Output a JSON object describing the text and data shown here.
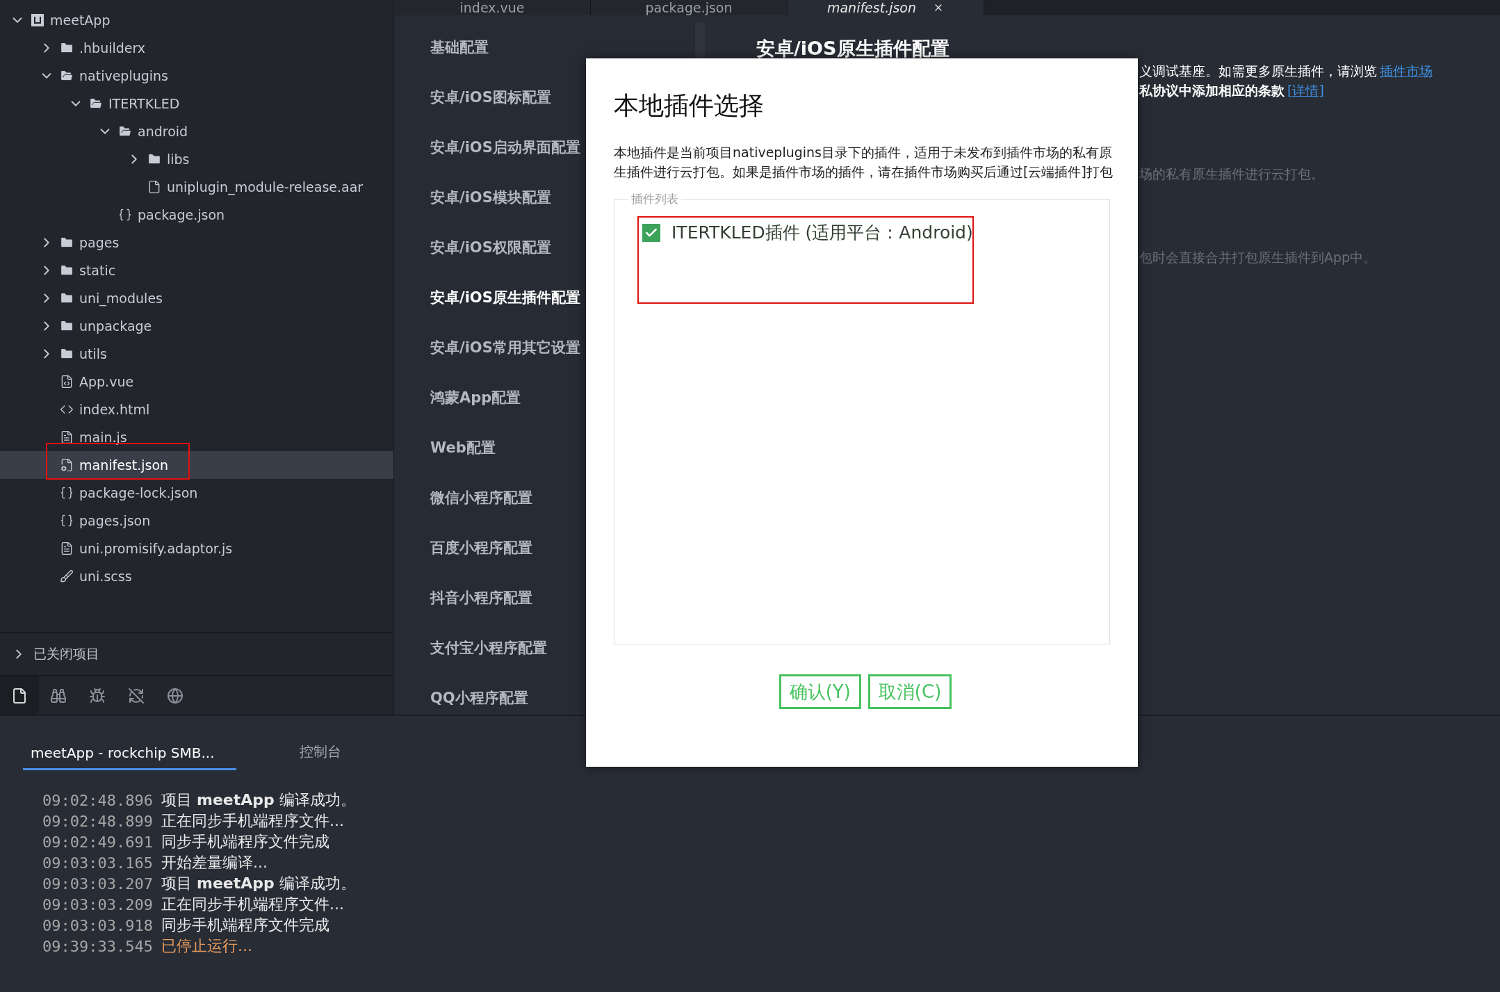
{
  "tree": [
    {
      "name": "meetApp",
      "kind": "project",
      "expanded": true,
      "selected": false,
      "children": [
        {
          "name": ".hbuilderx",
          "kind": "folder",
          "expanded": false,
          "selected": false
        },
        {
          "name": "nativeplugins",
          "kind": "folder",
          "expanded": true,
          "selected": false,
          "children": [
            {
              "name": "ITERTKLED",
              "kind": "folder",
              "expanded": true,
              "selected": false,
              "children": [
                {
                  "name": "android",
                  "kind": "folder",
                  "expanded": true,
                  "selected": false,
                  "children": [
                    {
                      "name": "libs",
                      "kind": "folder",
                      "expanded": false,
                      "selected": false
                    },
                    {
                      "name": "uniplugin_module-release.aar",
                      "kind": "file",
                      "selected": false
                    }
                  ]
                },
                {
                  "name": "package.json",
                  "kind": "json",
                  "selected": false
                }
              ]
            }
          ]
        },
        {
          "name": "pages",
          "kind": "folder",
          "expanded": false,
          "selected": false
        },
        {
          "name": "static",
          "kind": "folder",
          "expanded": false,
          "selected": false
        },
        {
          "name": "uni_modules",
          "kind": "folder",
          "expanded": false,
          "selected": false
        },
        {
          "name": "unpackage",
          "kind": "folder",
          "expanded": false,
          "selected": false
        },
        {
          "name": "utils",
          "kind": "folder",
          "expanded": false,
          "selected": false
        },
        {
          "name": "App.vue",
          "kind": "vue",
          "selected": false
        },
        {
          "name": "index.html",
          "kind": "html",
          "selected": false
        },
        {
          "name": "main.js",
          "kind": "js",
          "selected": false
        },
        {
          "name": "manifest.json",
          "kind": "manifest",
          "selected": true
        },
        {
          "name": "package-lock.json",
          "kind": "json",
          "selected": false
        },
        {
          "name": "pages.json",
          "kind": "json",
          "selected": false
        },
        {
          "name": "uni.promisify.adaptor.js",
          "kind": "js",
          "selected": false
        },
        {
          "name": "uni.scss",
          "kind": "style",
          "selected": false
        }
      ]
    }
  ],
  "closed_projects": {
    "label": "已关闭项目",
    "expanded": false
  },
  "sidebar_tools": [
    {
      "kind": "files",
      "selected": true
    },
    {
      "kind": "search",
      "selected": false
    },
    {
      "kind": "debug",
      "selected": false
    },
    {
      "kind": "publish",
      "selected": false
    },
    {
      "kind": "cloud",
      "selected": false
    }
  ],
  "editor_tabs": [
    {
      "label": "index.vue",
      "selected": false
    },
    {
      "label": "package.json",
      "selected": false
    },
    {
      "label": "manifest.json",
      "selected": true
    }
  ],
  "settings_nav": [
    {
      "label": "基础配置",
      "selected": false
    },
    {
      "label": "安卓/iOS图标配置",
      "selected": false
    },
    {
      "label": "安卓/iOS启动界面配置",
      "selected": false
    },
    {
      "label": "安卓/iOS模块配置",
      "selected": false
    },
    {
      "label": "安卓/iOS权限配置",
      "selected": false
    },
    {
      "label": "安卓/iOS原生插件配置",
      "selected": true
    },
    {
      "label": "安卓/iOS常用其它设置",
      "selected": false
    },
    {
      "label": "鸿蒙App配置",
      "selected": false
    },
    {
      "label": "Web配置",
      "selected": false
    },
    {
      "label": "微信小程序配置",
      "selected": false
    },
    {
      "label": "百度小程序配置",
      "selected": false
    },
    {
      "label": "抖音小程序配置",
      "selected": false
    },
    {
      "label": "支付宝小程序配置",
      "selected": false
    },
    {
      "label": "QQ小程序配置",
      "selected": false
    }
  ],
  "content": {
    "heading": "安卓/iOS原生插件配置",
    "paragraphs": [
      {
        "kind": "normal",
        "text": "义调试基座。如需更多原生插件，请浏览",
        "link": "插件市场"
      },
      {
        "kind": "bold",
        "text": "私协议中添加相应的条款",
        "link": "[详情]"
      },
      {
        "kind": "muted",
        "text": "场的私有原生插件进行云打包。"
      },
      {
        "kind": "muted",
        "text": "包时会直接合并打包原生插件到App中。"
      }
    ]
  },
  "dialog": {
    "title": "本地插件选择",
    "description": "本地插件是当前项目nativeplugins目录下的插件，适用于未发布到插件市场的私有原生插件进行云打包。如果是插件市场的插件，请在插件市场购买后通过[云端插件]打包",
    "group_label": "插件列表",
    "plugins": [
      {
        "label": "ITERTKLED插件 (适用平台：Android)",
        "checked": true
      }
    ],
    "buttons": [
      "确认(Y)",
      "取消(C)"
    ]
  },
  "console": {
    "tabs": [
      {
        "label": "meetApp - rockchip SMB...",
        "selected": true
      },
      {
        "label": "控制台",
        "selected": false
      }
    ],
    "lines": [
      {
        "time": "09:02:48.896",
        "text": "项目 **meetApp** 编译成功。",
        "kind": "info"
      },
      {
        "time": "09:02:48.899",
        "text": "正在同步手机端程序文件...",
        "kind": "info"
      },
      {
        "time": "09:02:49.691",
        "text": "同步手机端程序文件完成",
        "kind": "info"
      },
      {
        "time": "09:03:03.165",
        "text": "开始差量编译...",
        "kind": "info"
      },
      {
        "time": "09:03:03.207",
        "text": "项目 **meetApp** 编译成功。",
        "kind": "info"
      },
      {
        "time": "09:03:03.209",
        "text": "正在同步手机端程序文件...",
        "kind": "info"
      },
      {
        "time": "09:03:03.918",
        "text": "同步手机端程序文件完成",
        "kind": "info"
      },
      {
        "time": "09:39:33.545",
        "text": "已停止运行...",
        "kind": "stopped"
      }
    ]
  }
}
